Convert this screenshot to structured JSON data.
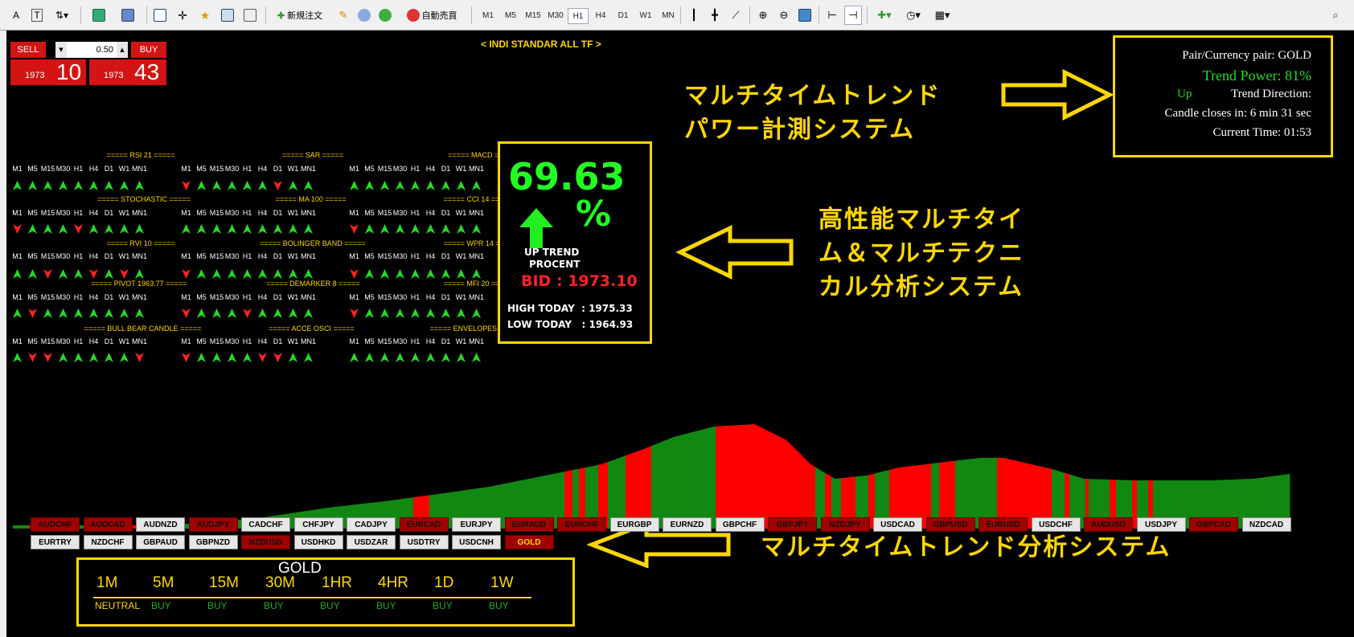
{
  "toolbar": {
    "order_label": "新規注文",
    "auto_label": "自動売買",
    "timeframes": [
      "M1",
      "M5",
      "M15",
      "M30",
      "H1",
      "H4",
      "D1",
      "W1",
      "MN"
    ],
    "active_tf": "H1"
  },
  "trade_panel": {
    "sell": "SELL",
    "buy": "BUY",
    "lot": "0.50",
    "sell_big": "1973",
    "sell_small": "10",
    "buy_big": "1973",
    "buy_small": "43"
  },
  "indicator_title": "< INDI STANDAR ALL TF >",
  "info_box": {
    "pair": "Pair/Currency pair: GOLD",
    "power": "Trend Power: 81%",
    "dir_value": "Up",
    "dir_label": "Trend Direction:",
    "candle": "Candle closes in: 6 min 31 sec",
    "time": "Current Time: 01:53"
  },
  "jp_texts": {
    "t1a": "マルチタイムトレンド",
    "t1b": "パワー計測システム",
    "t2a": "高性能マルチタイ",
    "t2b": "ム＆マルチテクニ",
    "t2c": "カル分析システム",
    "t3": "マルチタイムトレンド分析システム"
  },
  "tf_labels": [
    "M1",
    "M5",
    "M15",
    "M30",
    "H1",
    "H4",
    "D1",
    "W1",
    "MN1"
  ],
  "indicators": [
    {
      "name": "===== RSI 21 =====",
      "arrows": [
        "u",
        "u",
        "u",
        "u",
        "u",
        "u",
        "u",
        "u",
        "u"
      ]
    },
    {
      "name": "===== SAR =====",
      "arrows": [
        "d",
        "u",
        "u",
        "u",
        "u",
        "u",
        "d",
        "u",
        "u"
      ]
    },
    {
      "name": "===== MACD =====",
      "arrows": [
        "u",
        "u",
        "u",
        "u",
        "u",
        "u",
        "u",
        "u",
        "u"
      ]
    },
    {
      "name": "===== STOCHASTIC =====",
      "arrows": [
        "d",
        "u",
        "u",
        "u",
        "d",
        "u",
        "u",
        "u",
        "u"
      ]
    },
    {
      "name": "===== MA 100 =====",
      "arrows": [
        "u",
        "u",
        "u",
        "u",
        "u",
        "u",
        "u",
        "u",
        "u"
      ]
    },
    {
      "name": "===== CCI 14 =====",
      "arrows": [
        "d",
        "u",
        "u",
        "u",
        "u",
        "u",
        "u",
        "u",
        "u"
      ]
    },
    {
      "name": "===== RVI 10 =====",
      "arrows": [
        "u",
        "u",
        "d",
        "u",
        "u",
        "d",
        "u",
        "d",
        "u"
      ]
    },
    {
      "name": "===== BOLINGER BAND =====",
      "arrows": [
        "d",
        "u",
        "u",
        "u",
        "u",
        "u",
        "u",
        "u",
        "u"
      ]
    },
    {
      "name": "===== WPR 14 =====",
      "arrows": [
        "d",
        "u",
        "u",
        "u",
        "u",
        "u",
        "u",
        "u",
        "u"
      ]
    },
    {
      "name": "===== PIVOT 1963.77 =====",
      "arrows": [
        "u",
        "d",
        "u",
        "u",
        "u",
        "u",
        "u",
        "u",
        "u"
      ]
    },
    {
      "name": "===== DEMARKER 8 =====",
      "arrows": [
        "d",
        "u",
        "u",
        "u",
        "d",
        "u",
        "u",
        "u",
        "u"
      ]
    },
    {
      "name": "===== MFI 20 =====",
      "arrows": [
        "d",
        "u",
        "u",
        "u",
        "u",
        "u",
        "u",
        "u",
        "u"
      ]
    },
    {
      "name": "===== BULL BEAR CANDLE =====",
      "arrows": [
        "u",
        "d",
        "d",
        "u",
        "u",
        "u",
        "u",
        "u",
        "d"
      ]
    },
    {
      "name": "===== ACCE OSCI =====",
      "arrows": [
        "d",
        "u",
        "u",
        "u",
        "u",
        "d",
        "d",
        "u",
        "u"
      ]
    },
    {
      "name": "===== ENVELOPES 14 =====",
      "arrows": [
        "u",
        "u",
        "u",
        "u",
        "u",
        "u",
        "u",
        "u",
        "u"
      ]
    }
  ],
  "center_box": {
    "percent": "69.63",
    "pct_sign": "%",
    "trend": "UP TREND",
    "procent": "PROCENT",
    "bid": "BID : 1973.10",
    "high": "HIGH TODAY  : 1975.33",
    "low": "LOW TODAY   : 1964.93"
  },
  "pairs_row1": [
    [
      "AUDCHF",
      "r"
    ],
    [
      "AUDCAD",
      "r"
    ],
    [
      "AUDNZD",
      "g"
    ],
    [
      "AUDJPY",
      "r"
    ],
    [
      "CADCHF",
      "g"
    ],
    [
      "CHFJPY",
      "g"
    ],
    [
      "CADJPY",
      "g"
    ],
    [
      "EURCAD",
      "r"
    ],
    [
      "EURJPY",
      "g"
    ],
    [
      "EURAUD",
      "r"
    ],
    [
      "EURCHF",
      "r"
    ],
    [
      "EURGBP",
      "g"
    ],
    [
      "EURNZD",
      "g"
    ],
    [
      "GBPCHF",
      "g"
    ],
    [
      "GBPJPY",
      "r"
    ],
    [
      "NZDJPY",
      "r"
    ],
    [
      "USDCAD",
      "g"
    ],
    [
      "GBPUSD",
      "r"
    ],
    [
      "EURUSD",
      "r"
    ],
    [
      "USDCHF",
      "g"
    ],
    [
      "AUDUSD",
      "r"
    ],
    [
      "USDJPY",
      "g"
    ],
    [
      "GBPCAD",
      "r"
    ],
    [
      "NZDCAD",
      "g"
    ]
  ],
  "pairs_row2": [
    [
      "EURTRY",
      "g"
    ],
    [
      "NZDCHF",
      "g"
    ],
    [
      "GBPAUD",
      "g"
    ],
    [
      "GBPNZD",
      "g"
    ],
    [
      "NZDUSD",
      "r"
    ],
    [
      "USDHKD",
      "g"
    ],
    [
      "USDZAR",
      "g"
    ],
    [
      "USDTRY",
      "g"
    ],
    [
      "USDCNH",
      "g"
    ],
    [
      "GOLD",
      "gold"
    ]
  ],
  "mtf": {
    "symbol": "GOLD",
    "tfs": [
      "1M",
      "5M",
      "15M",
      "30M",
      "1HR",
      "4HR",
      "1D",
      "1W"
    ],
    "signals": [
      "NEUTRAL",
      "BUY",
      "BUY",
      "BUY",
      "BUY",
      "BUY",
      "BUY",
      "BUY"
    ]
  },
  "colors": {
    "up": "#22dd22",
    "down": "#ff2222",
    "accent": "#ffd700",
    "area_green": "#118811",
    "area_red": "#ff0000"
  }
}
